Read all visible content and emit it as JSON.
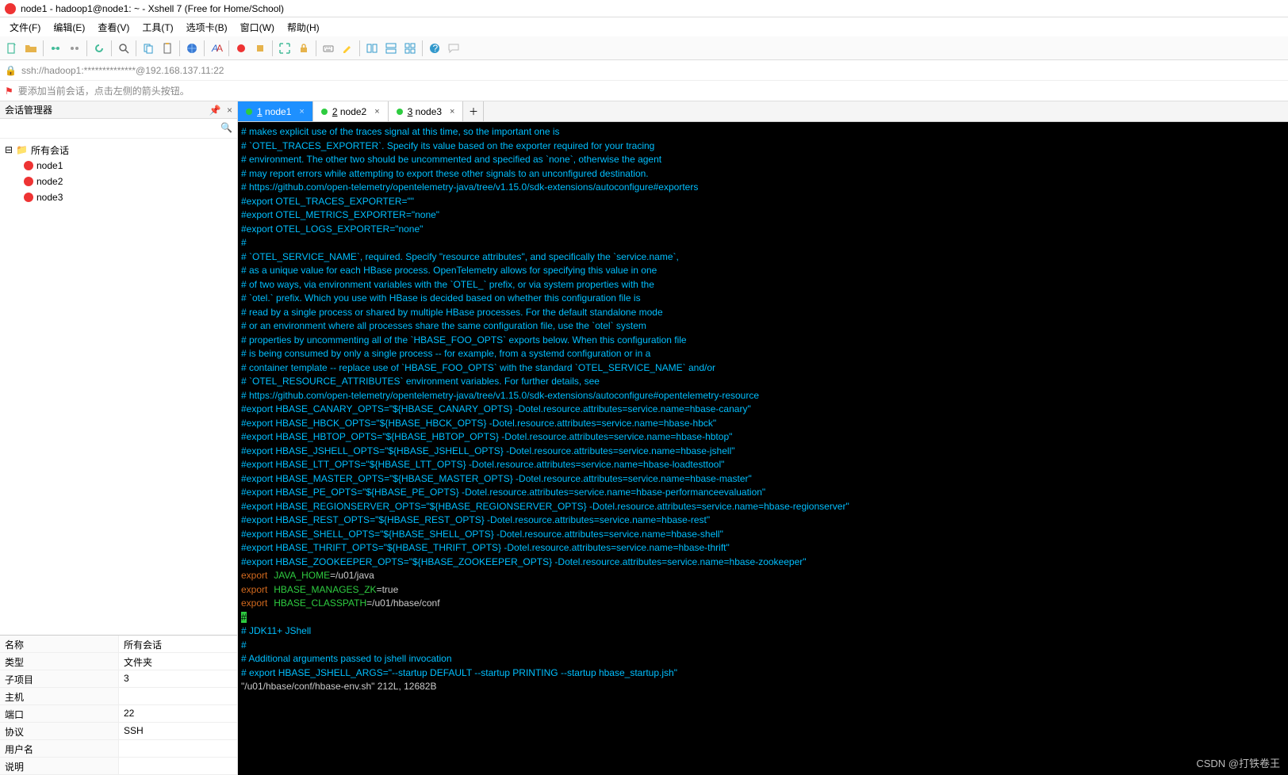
{
  "title": "node1 - hadoop1@node1: ~ - Xshell 7 (Free for Home/School)",
  "menubar": [
    "文件(F)",
    "编辑(E)",
    "查看(V)",
    "工具(T)",
    "选项卡(B)",
    "窗口(W)",
    "帮助(H)"
  ],
  "address": "ssh://hadoop1:**************@192.168.137.11:22",
  "hint": "要添加当前会话，点击左侧的箭头按钮。",
  "sidebar": {
    "title": "会话管理器",
    "root": "所有会话",
    "nodes": [
      "node1",
      "node2",
      "node3"
    ],
    "props": [
      {
        "k": "名称",
        "v": "所有会话"
      },
      {
        "k": "类型",
        "v": "文件夹"
      },
      {
        "k": "子项目",
        "v": "3"
      },
      {
        "k": "主机",
        "v": ""
      },
      {
        "k": "端口",
        "v": "22"
      },
      {
        "k": "协议",
        "v": "SSH"
      },
      {
        "k": "用户名",
        "v": ""
      },
      {
        "k": "说明",
        "v": ""
      }
    ]
  },
  "tabs": [
    {
      "n": "1",
      "label": "node1",
      "active": true
    },
    {
      "n": "2",
      "label": "node2",
      "active": false
    },
    {
      "n": "3",
      "label": "node3",
      "active": false
    }
  ],
  "term": {
    "lines": [
      {
        "cls": "c-cyan",
        "t": "# makes explicit use of the traces signal at this time, so the important one is"
      },
      {
        "cls": "c-cyan",
        "t": "# `OTEL_TRACES_EXPORTER`. Specify its value based on the exporter required for your tracing"
      },
      {
        "cls": "c-cyan",
        "t": "# environment. The other two should be uncommented and specified as `none`, otherwise the agent"
      },
      {
        "cls": "c-cyan",
        "t": "# may report errors while attempting to export these other signals to an unconfigured destination."
      },
      {
        "cls": "c-cyan",
        "t": "# https://github.com/open-telemetry/opentelemetry-java/tree/v1.15.0/sdk-extensions/autoconfigure#exporters"
      },
      {
        "cls": "c-cyan",
        "t": "#export OTEL_TRACES_EXPORTER=\"\""
      },
      {
        "cls": "c-cyan",
        "t": "#export OTEL_METRICS_EXPORTER=\"none\""
      },
      {
        "cls": "c-cyan",
        "t": "#export OTEL_LOGS_EXPORTER=\"none\""
      },
      {
        "cls": "c-cyan",
        "t": "#"
      },
      {
        "cls": "c-cyan",
        "t": "# `OTEL_SERVICE_NAME`, required. Specify \"resource attributes\", and specifically the `service.name`,"
      },
      {
        "cls": "c-cyan",
        "t": "# as a unique value for each HBase process. OpenTelemetry allows for specifying this value in one"
      },
      {
        "cls": "c-cyan",
        "t": "# of two ways, via environment variables with the `OTEL_` prefix, or via system properties with the"
      },
      {
        "cls": "c-cyan",
        "t": "# `otel.` prefix. Which you use with HBase is decided based on whether this configuration file is"
      },
      {
        "cls": "c-cyan",
        "t": "# read by a single process or shared by multiple HBase processes. For the default standalone mode"
      },
      {
        "cls": "c-cyan",
        "t": "# or an environment where all processes share the same configuration file, use the `otel` system"
      },
      {
        "cls": "c-cyan",
        "t": "# properties by uncommenting all of the `HBASE_FOO_OPTS` exports below. When this configuration file"
      },
      {
        "cls": "c-cyan",
        "t": "# is being consumed by only a single process -- for example, from a systemd configuration or in a"
      },
      {
        "cls": "c-cyan",
        "t": "# container template -- replace use of `HBASE_FOO_OPTS` with the standard `OTEL_SERVICE_NAME` and/or"
      },
      {
        "cls": "c-cyan",
        "t": "# `OTEL_RESOURCE_ATTRIBUTES` environment variables. For further details, see"
      },
      {
        "cls": "c-cyan",
        "t": "# https://github.com/open-telemetry/opentelemetry-java/tree/v1.15.0/sdk-extensions/autoconfigure#opentelemetry-resource"
      },
      {
        "cls": "c-cyan",
        "t": "#export HBASE_CANARY_OPTS=\"${HBASE_CANARY_OPTS} -Dotel.resource.attributes=service.name=hbase-canary\""
      },
      {
        "cls": "c-cyan",
        "t": "#export HBASE_HBCK_OPTS=\"${HBASE_HBCK_OPTS} -Dotel.resource.attributes=service.name=hbase-hbck\""
      },
      {
        "cls": "c-cyan",
        "t": "#export HBASE_HBTOP_OPTS=\"${HBASE_HBTOP_OPTS} -Dotel.resource.attributes=service.name=hbase-hbtop\""
      },
      {
        "cls": "c-cyan",
        "t": "#export HBASE_JSHELL_OPTS=\"${HBASE_JSHELL_OPTS} -Dotel.resource.attributes=service.name=hbase-jshell\""
      },
      {
        "cls": "c-cyan",
        "t": "#export HBASE_LTT_OPTS=\"${HBASE_LTT_OPTS} -Dotel.resource.attributes=service.name=hbase-loadtesttool\""
      },
      {
        "cls": "c-cyan",
        "t": "#export HBASE_MASTER_OPTS=\"${HBASE_MASTER_OPTS} -Dotel.resource.attributes=service.name=hbase-master\""
      },
      {
        "cls": "c-cyan",
        "t": "#export HBASE_PE_OPTS=\"${HBASE_PE_OPTS} -Dotel.resource.attributes=service.name=hbase-performanceevaluation\""
      },
      {
        "cls": "c-cyan",
        "t": "#export HBASE_REGIONSERVER_OPTS=\"${HBASE_REGIONSERVER_OPTS} -Dotel.resource.attributes=service.name=hbase-regionserver\""
      },
      {
        "cls": "c-cyan",
        "t": "#export HBASE_REST_OPTS=\"${HBASE_REST_OPTS} -Dotel.resource.attributes=service.name=hbase-rest\""
      },
      {
        "cls": "c-cyan",
        "t": "#export HBASE_SHELL_OPTS=\"${HBASE_SHELL_OPTS} -Dotel.resource.attributes=service.name=hbase-shell\""
      },
      {
        "cls": "c-cyan",
        "t": "#export HBASE_THRIFT_OPTS=\"${HBASE_THRIFT_OPTS} -Dotel.resource.attributes=service.name=hbase-thrift\""
      },
      {
        "cls": "c-cyan",
        "t": "#export HBASE_ZOOKEEPER_OPTS=\"${HBASE_ZOOKEEPER_OPTS} -Dotel.resource.attributes=service.name=hbase-zookeeper\""
      }
    ],
    "exports": [
      {
        "var": "JAVA_HOME",
        "val": "=/u01/java"
      },
      {
        "var": "HBASE_MANAGES_ZK",
        "val": "=true"
      },
      {
        "var": "HBASE_CLASSPATH",
        "val": "=/u01/hbase/conf"
      }
    ],
    "cursor": "#",
    "tail": [
      {
        "cls": "c-cyan",
        "t": "# JDK11+ JShell"
      },
      {
        "cls": "c-cyan",
        "t": "#"
      },
      {
        "cls": "c-cyan",
        "t": "# Additional arguments passed to jshell invocation"
      },
      {
        "cls": "c-cyan",
        "t": "# export HBASE_JSHELL_ARGS=\"--startup DEFAULT --startup PRINTING --startup hbase_startup.jsh\""
      }
    ],
    "status": "\"/u01/hbase/conf/hbase-env.sh\" 212L, 12682B"
  },
  "watermark": "CSDN @打铁卷王"
}
